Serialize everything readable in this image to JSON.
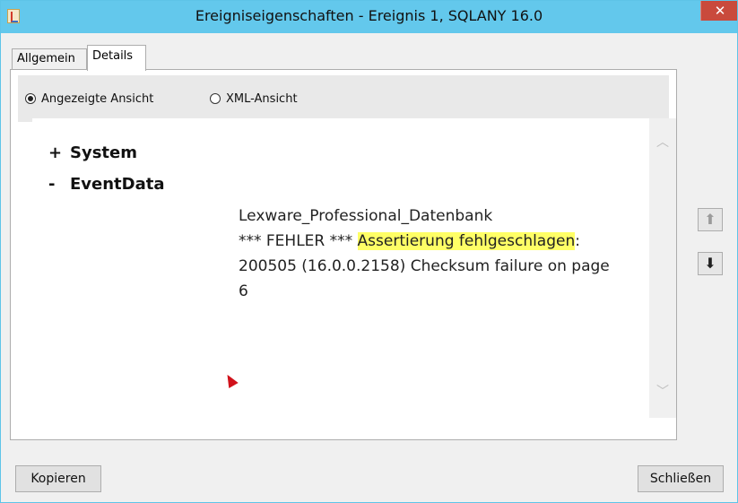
{
  "window": {
    "title": "Ereigniseigenschaften - Ereignis 1, SQLANY 16.0",
    "close_glyph": "✕"
  },
  "tabs": [
    {
      "label": "Allgemein",
      "selected": false
    },
    {
      "label": "Details",
      "selected": true
    }
  ],
  "view_options": {
    "rendered": {
      "label": "Angezeigte Ansicht",
      "checked": true
    },
    "xml": {
      "label": "XML-Ansicht",
      "checked": false
    }
  },
  "tree": {
    "system": {
      "sign": "+",
      "name": "System"
    },
    "eventdata": {
      "sign": "-",
      "name": "EventData"
    }
  },
  "event_data": {
    "line1": "Lexware_Professional_Datenbank",
    "line2_prefix": "*** FEHLER *** ",
    "line2_highlight": "Assertierung fehlgeschlagen",
    "line2_suffix": ":",
    "line3": "200505 (16.0.0.2158) Checksum failure on page",
    "line4": "6"
  },
  "nav": {
    "prev_glyph": "⬆",
    "next_glyph": "⬇"
  },
  "footer": {
    "copy_label": "Kopieren",
    "close_label": "Schließen"
  },
  "colors": {
    "titlebar": "#63c8ec",
    "highlight": "#ffff66",
    "close": "#c94a3c"
  }
}
